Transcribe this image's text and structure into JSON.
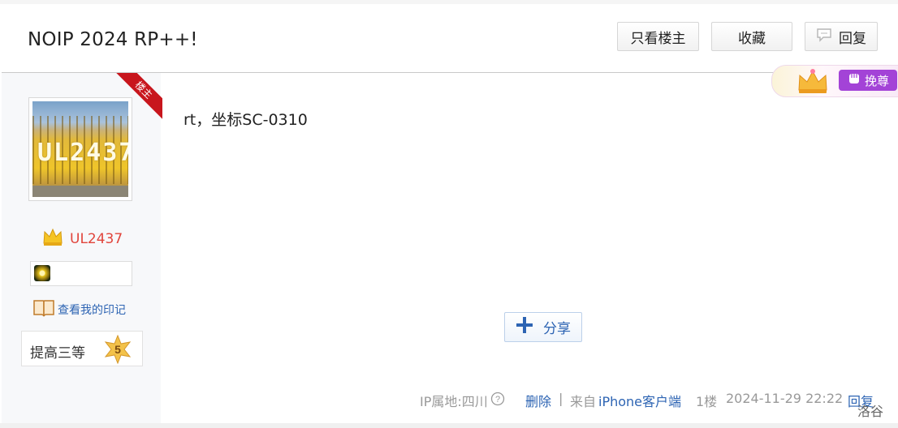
{
  "header": {
    "title": "NOIP 2024 RP++!",
    "only_op_label": "只看楼主",
    "favorite_label": "收藏",
    "reply_label": "回复"
  },
  "author": {
    "op_ribbon": "楼主",
    "username": "UL2437",
    "avatar_text": "UL2437",
    "imprint_link": "查看我的印记",
    "level_title": "提高三等",
    "level_number": "5"
  },
  "post": {
    "content": "rt，坐标SC-0310",
    "share_label": "分享"
  },
  "vote_badge": {
    "label": "挽尊"
  },
  "footer": {
    "ip_location": "IP属地:四川",
    "delete_label": "删除",
    "separator": "|",
    "from_prefix": "来自",
    "client_name": "iPhone客户端",
    "floor": "1楼",
    "timestamp": "2024-11-29 22:22",
    "reply_label": "回复"
  },
  "watermark": "洛谷",
  "colors": {
    "link": "#2d64b3",
    "username": "#e1453c",
    "op_ribbon": "#c8161d",
    "vote_pill": "#a343d7"
  }
}
